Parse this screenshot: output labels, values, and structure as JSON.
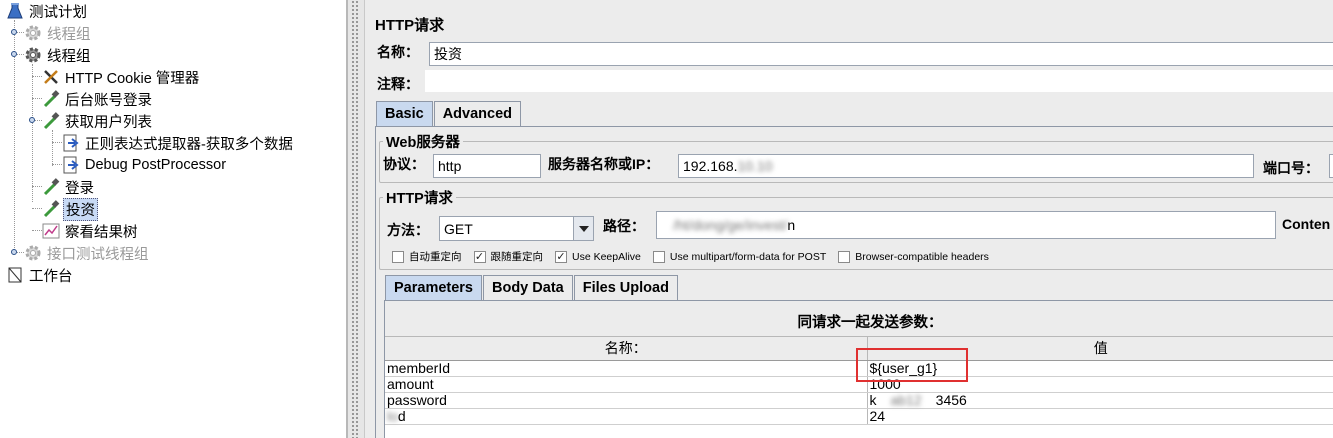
{
  "tree": {
    "nodes": [
      {
        "label": "测试计划",
        "icon": "test-plan-icon",
        "disabled": false,
        "selected": false
      },
      {
        "label": "线程组",
        "icon": "thread-group-gear-icon",
        "disabled": true,
        "selected": false
      },
      {
        "label": "线程组",
        "icon": "thread-group-gear-icon",
        "disabled": false,
        "selected": false
      },
      {
        "label": "HTTP Cookie 管理器",
        "icon": "config-tools-icon",
        "disabled": false,
        "selected": false
      },
      {
        "label": "后台账号登录",
        "icon": "sampler-pipette-icon",
        "disabled": false,
        "selected": false
      },
      {
        "label": "获取用户列表",
        "icon": "sampler-pipette-icon",
        "disabled": false,
        "selected": false
      },
      {
        "label": "正则表达式提取器-获取多个数据",
        "icon": "post-processor-icon",
        "disabled": false,
        "selected": false
      },
      {
        "label": "Debug PostProcessor",
        "icon": "post-processor-icon",
        "disabled": false,
        "selected": false
      },
      {
        "label": "登录",
        "icon": "sampler-pipette-icon",
        "disabled": false,
        "selected": false
      },
      {
        "label": "投资",
        "icon": "sampler-pipette-icon",
        "disabled": false,
        "selected": true
      },
      {
        "label": "察看结果树",
        "icon": "listener-chart-icon",
        "disabled": false,
        "selected": false
      },
      {
        "label": "接口测试线程组",
        "icon": "thread-group-gear-icon",
        "disabled": true,
        "selected": false
      },
      {
        "label": "工作台",
        "icon": "workbench-icon",
        "disabled": false,
        "selected": false
      }
    ]
  },
  "panel": {
    "title": "HTTP请求",
    "name_label": "名称：",
    "name_value": "投资",
    "comment_label": "注释：",
    "tabs": [
      "Basic",
      "Advanced"
    ],
    "web_server": {
      "legend": "Web服务器",
      "protocol_label": "协议：",
      "protocol_value": "http",
      "server_label": "服务器名称或IP：",
      "server_value": "192.168.",
      "server_value_blurred": "10.10",
      "port_label": "端口号："
    },
    "http_request": {
      "legend": "HTTP请求",
      "method_label": "方法：",
      "method_value": "GET",
      "path_label": "路径：",
      "path_blurred": "/ht/dong/ge/invest/",
      "path_tail": "n",
      "content_label": "Conten"
    },
    "checkboxes": [
      {
        "label": "自动重定向",
        "checked": false
      },
      {
        "label": "跟随重定向",
        "checked": true
      },
      {
        "label": "Use KeepAlive",
        "checked": true
      },
      {
        "label": "Use multipart/form-data for POST",
        "checked": false
      },
      {
        "label": "Browser-compatible headers",
        "checked": false
      }
    ],
    "sub_tabs": [
      "Parameters",
      "Body Data",
      "Files Upload"
    ],
    "params_caption": "同请求一起发送参数：",
    "params_headers": [
      "名称：",
      "值"
    ],
    "params_rows": [
      {
        "name": "memberId",
        "value": "${user_g1}"
      },
      {
        "name": "amount",
        "value": "1000"
      },
      {
        "name": "password",
        "value": "k",
        "value_tail": "3456",
        "value_blurred": "ab12"
      },
      {
        "name_blurred": "lo",
        "name": "d",
        "value": "24"
      }
    ],
    "highlight_color": "#e03030"
  }
}
